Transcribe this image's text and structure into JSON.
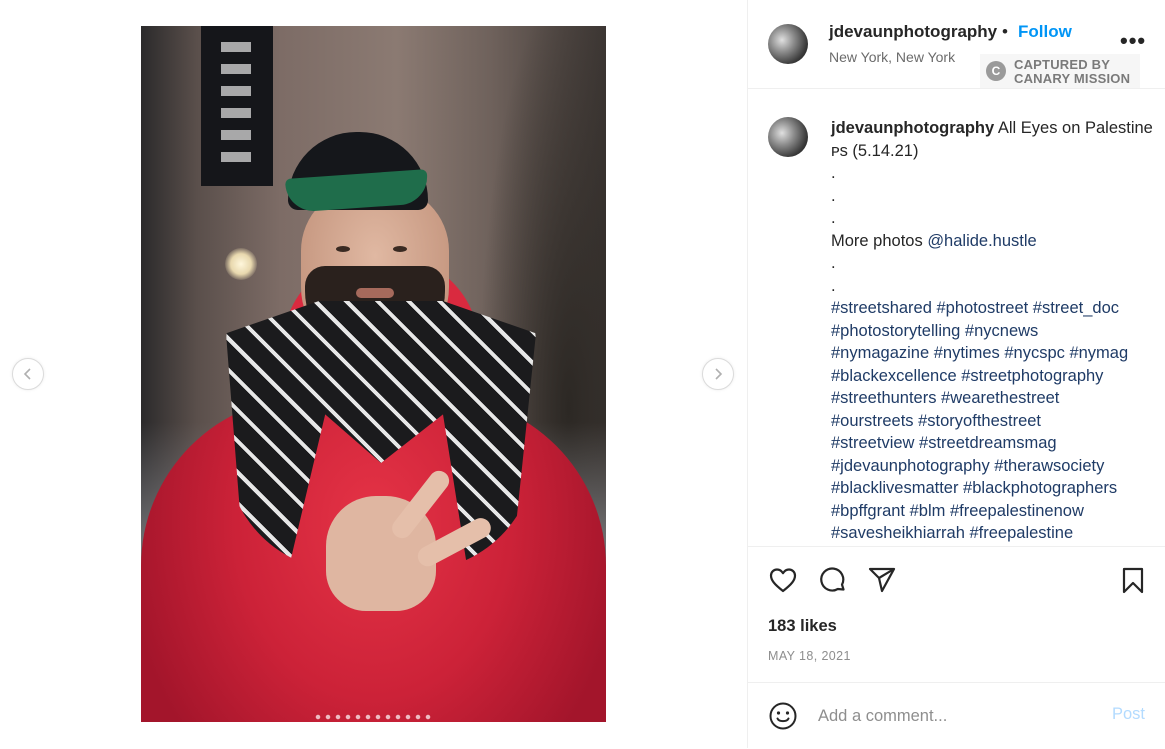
{
  "post": {
    "username": "jdevaunphotography",
    "separator": "•",
    "follow_label": "Follow",
    "location": "New York, New York",
    "more_label": "•••",
    "watermark": {
      "line1": "CAPTURED BY",
      "line2": "CANARY MISSION"
    }
  },
  "caption": {
    "username": "jdevaunphotography",
    "title": " All Eyes on Palestine ᴘs (5.14.21)",
    "lines": [
      ".",
      ".",
      "."
    ],
    "more_photos_prefix": "More photos ",
    "more_photos_mention": "@halide.hustle",
    "lines2": [
      ".",
      "."
    ],
    "hashtags": [
      "#streetshared #photostreet #street_doc",
      "#photostorytelling #nycnews",
      "#nymagazine #nytimes #nycspc #nymag",
      "#blackexcellence #streetphotography",
      "#streethunters #wearethestreet",
      "#ourstreets #storyofthestreet",
      "#streetview #streetdreamsmag",
      "#jdevaunphotography #therawsociety",
      "#blacklivesmatter #blackphotographers",
      "#bpffgrant #blm #freepalestinenow",
      "#savesheikhiarrah #freepalestine"
    ]
  },
  "engagement": {
    "likes": "183 likes",
    "date": "MAY 18, 2021"
  },
  "comment": {
    "placeholder": "Add a comment...",
    "post_label": "Post"
  },
  "colors": {
    "link": "#0095f6",
    "hashtag": "#1f3b66",
    "post_disabled": "#b3dbff"
  },
  "icons": [
    "chevron-left-icon",
    "chevron-right-icon",
    "heart-icon",
    "comment-icon",
    "share-icon",
    "bookmark-icon",
    "emoji-icon"
  ]
}
